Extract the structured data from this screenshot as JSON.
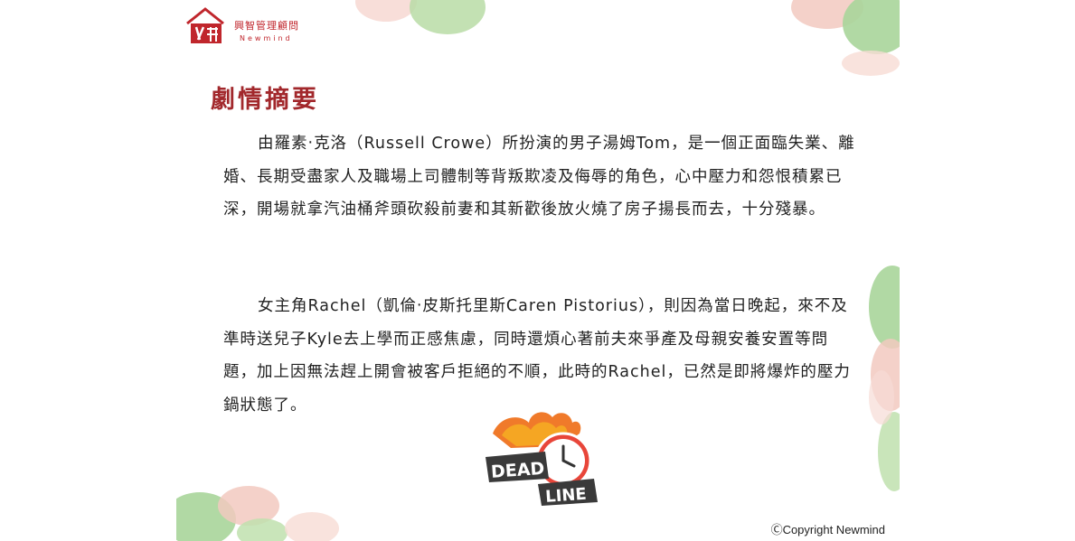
{
  "logo": {
    "name_cn": "興智管理顧問",
    "name_en": "Newmind"
  },
  "title": "劇情摘要",
  "paragraphs": {
    "p1": "由羅素‧克洛（Russell Crowe）所扮演的男子湯姆Tom，是一個正面臨失業、離婚、長期受盡家人及職場上司體制等背叛欺凌及侮辱的角色，心中壓力和怨恨積累已深，開場就拿汽油桶斧頭砍殺前妻和其新歡後放火燒了房子揚長而去，十分殘暴。",
    "p2": "女主角Rachel（凱倫‧皮斯托里斯Caren Pistorius），則因為當日晚起，來不及準時送兒子Kyle去上學而正感焦慮，同時還煩心著前夫來爭產及母親安養安置等問題，加上因無法趕上開會被客戶拒絕的不順，此時的Rachel，已然是即將爆炸的壓力鍋狀態了。"
  },
  "graphic": {
    "word1": "DEAD",
    "word2": "LINE"
  },
  "copyright": "ⒸCopyright Newmind",
  "colors": {
    "accent": "#a2282c",
    "green": "#a9d59a",
    "pink": "#f2c9c0"
  }
}
